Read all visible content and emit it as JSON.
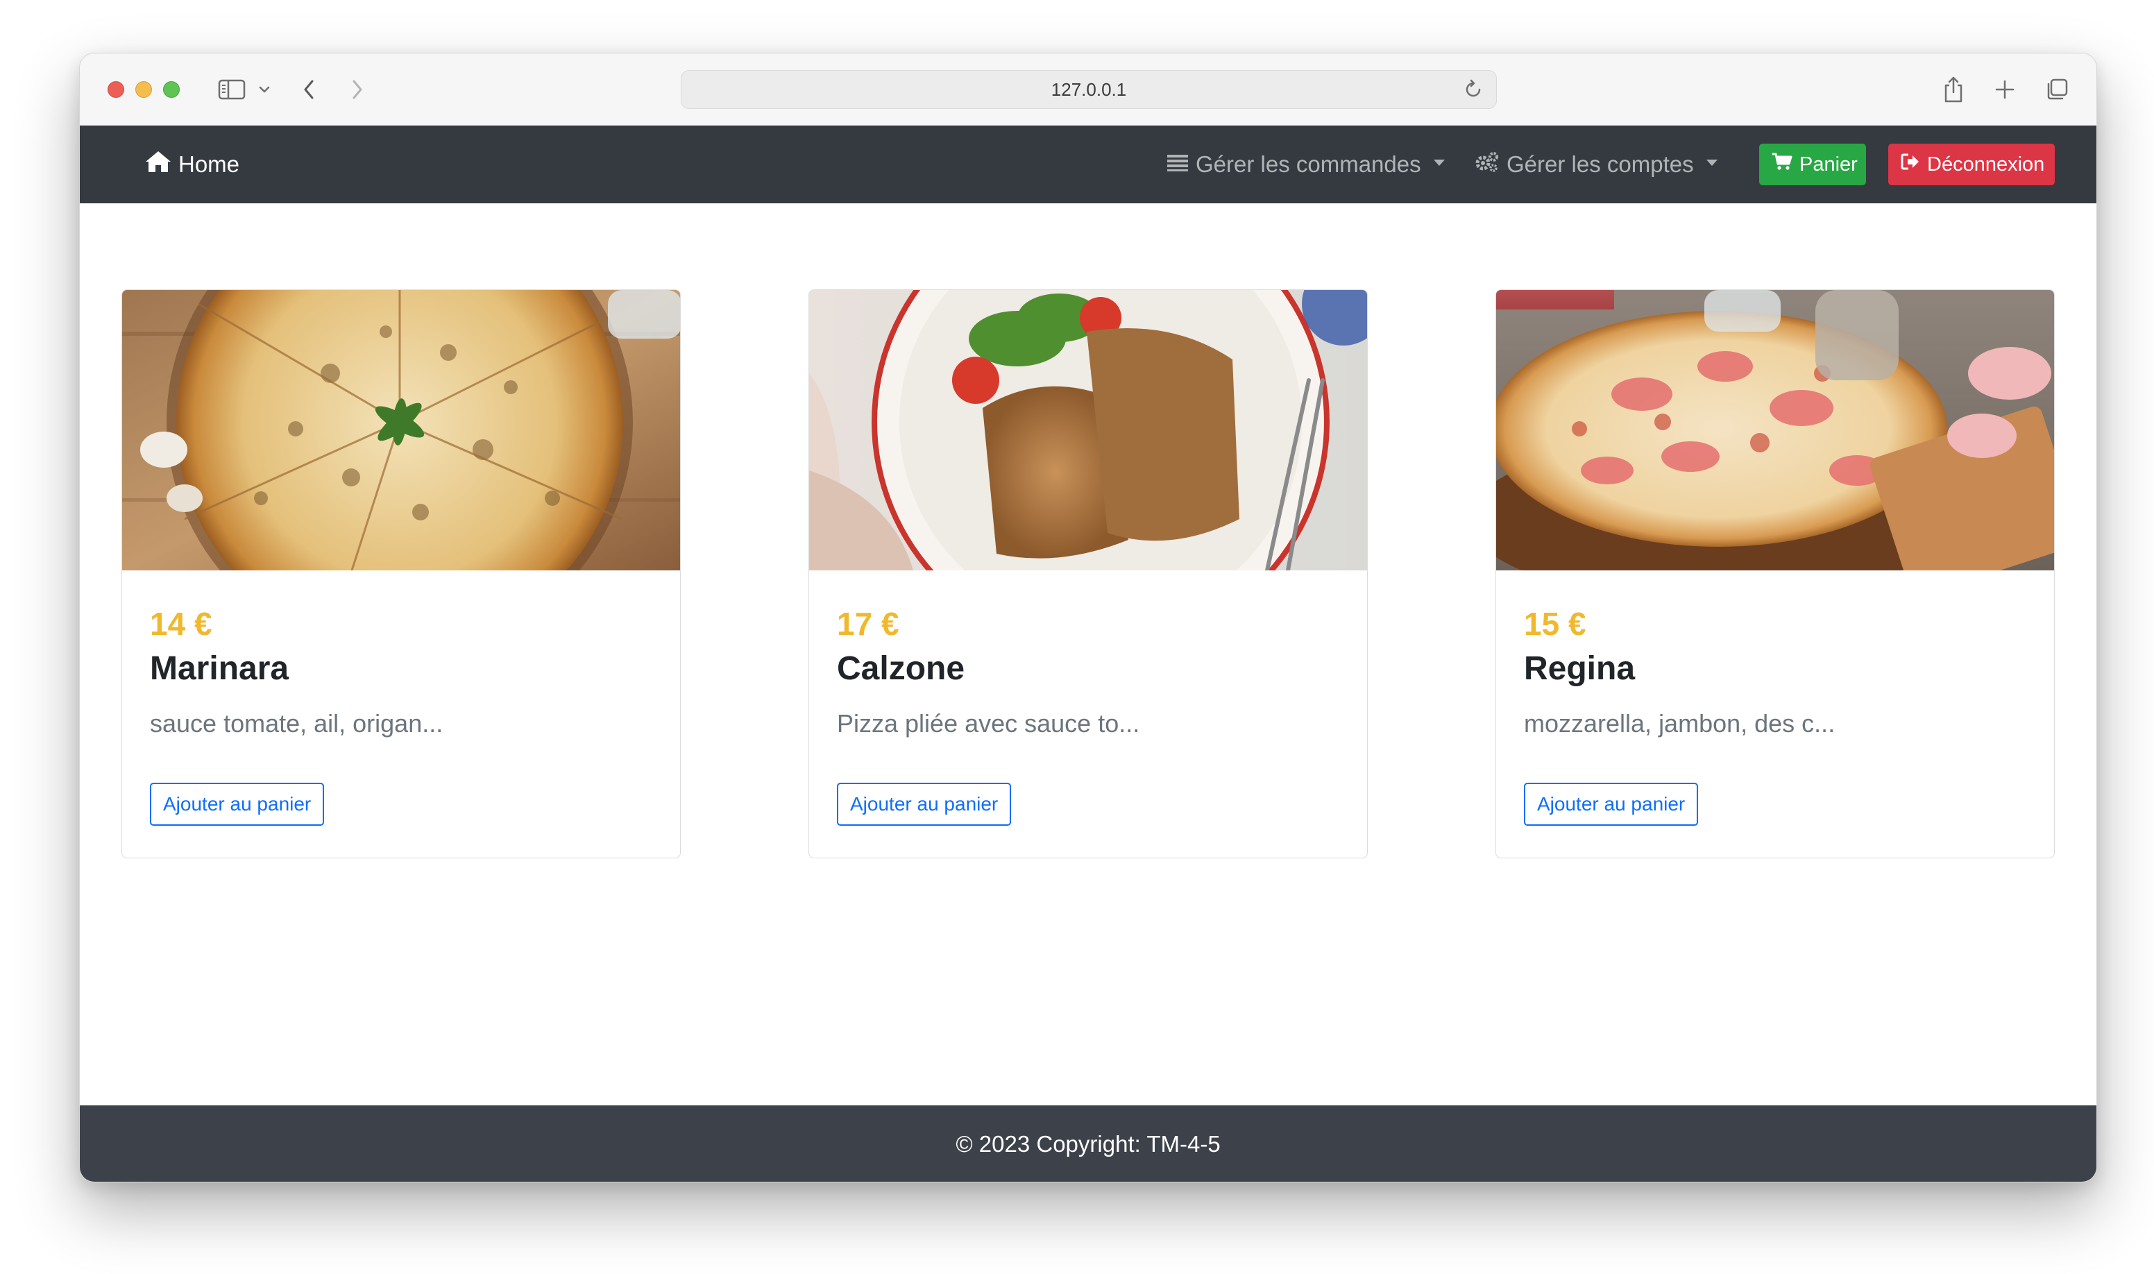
{
  "browser": {
    "url": "127.0.0.1",
    "icons": [
      "sidebar-icon",
      "chevron-down-icon",
      "back-icon",
      "forward-icon",
      "reload-icon",
      "share-icon",
      "new-tab-icon",
      "tabs-overview-icon"
    ]
  },
  "navbar": {
    "home_label": "Home",
    "manage_orders_label": "Gérer les commandes",
    "manage_accounts_label": "Gérer les comptes",
    "cart_label": "Panier",
    "logout_label": "Déconnexion",
    "colors": {
      "background": "#343a40",
      "cart": "#28a745",
      "logout": "#dc3545"
    }
  },
  "products": [
    {
      "price": "14 €",
      "name": "Marinara",
      "description": "sauce tomate, ail, origan...",
      "button_label": "Ajouter au panier"
    },
    {
      "price": "17 €",
      "name": "Calzone",
      "description": "Pizza pliée avec sauce to...",
      "button_label": "Ajouter au panier"
    },
    {
      "price": "15 €",
      "name": "Regina",
      "description": "mozzarella, jambon, des c...",
      "button_label": "Ajouter au panier"
    }
  ],
  "footer": {
    "text": "© 2023 Copyright: TM-4-5"
  },
  "theme": {
    "price_color": "#f0b92d",
    "outline_button_color": "#0d6efd"
  }
}
